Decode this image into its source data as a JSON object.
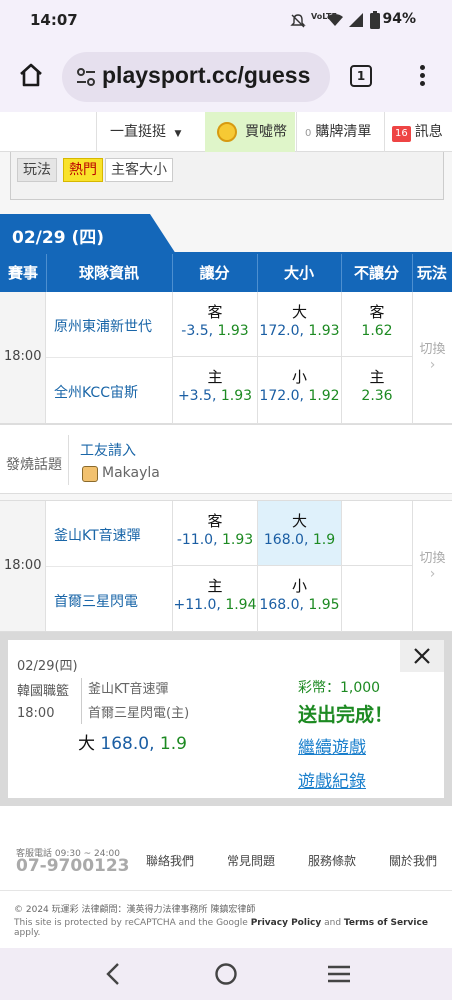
{
  "status": {
    "time": "14:07",
    "battery": "94%"
  },
  "browser": {
    "url": "playsport.cc/guess",
    "tab_count": "1"
  },
  "nav": {
    "dropdown": "一直挺挺",
    "buy_coins": "買噓幣",
    "cart_count": "0",
    "cart": "購牌清單",
    "msg_count": "16",
    "messages": "訊息"
  },
  "filters": [
    "玩法",
    "熱門",
    "主客大小"
  ],
  "date_tab": "02/29 (四)",
  "table_header": [
    "賽事",
    "球隊資訊",
    "讓分",
    "大小",
    "不讓分",
    "玩法"
  ],
  "games": [
    {
      "time": "18:00",
      "rows": [
        {
          "team": "原州東浦新世代",
          "spread_k": "客",
          "spread_v": "-3.5,",
          "spread_o": "1.93",
          "total_k": "大",
          "total_v": "172.0,",
          "total_o": "1.93",
          "ml_k": "客",
          "ml_o": "1.62"
        },
        {
          "team": "全州KCC宙斯",
          "spread_k": "主",
          "spread_v": "+3.5,",
          "spread_o": "1.93",
          "total_k": "小",
          "total_v": "172.0,",
          "total_o": "1.92",
          "ml_k": "主",
          "ml_o": "2.36"
        }
      ],
      "switch": "切換"
    },
    {
      "time": "18:00",
      "rows": [
        {
          "team": "釜山KT音速彈",
          "spread_k": "客",
          "spread_v": "-11.0,",
          "spread_o": "1.93",
          "total_k": "大",
          "total_v": "168.0,",
          "total_o": "1.9"
        },
        {
          "team": "首爾三星閃電",
          "spread_k": "主",
          "spread_v": "+11.0,",
          "spread_o": "1.94",
          "total_k": "小",
          "total_v": "168.0,",
          "total_o": "1.95"
        }
      ],
      "switch": "切換"
    }
  ],
  "talk": {
    "label": "發燒話題",
    "title": "工友請入",
    "user": "Makayla"
  },
  "popup": {
    "date": "02/29(四)",
    "league": "韓國職籃",
    "time": "18:00",
    "home": "釜山KT音速彈",
    "away": "首爾三星閃電(主)",
    "pick_k": "大",
    "pick_line": "168.0,",
    "pick_odd": "1.9",
    "coins": "彩幣：1,000",
    "done": "送出完成！",
    "continue": "繼續遊戲",
    "record": "遊戲紀錄"
  },
  "footer": {
    "hotline_label": "客服電話 09:30 ~ 24:00",
    "phone": "07-9700123",
    "links": [
      "聯絡我們",
      "常見問題",
      "服務條款",
      "關於我們"
    ],
    "copyright": "© 2024 玩運彩 法律顧問：漢英得力法律事務所 陳鎮宏律師",
    "recaptcha_pre": "This site is protected by reCAPTCHA and the Google",
    "privacy": "Privacy Policy",
    "and": "and",
    "terms": "Terms of Service",
    "apply": "apply."
  }
}
